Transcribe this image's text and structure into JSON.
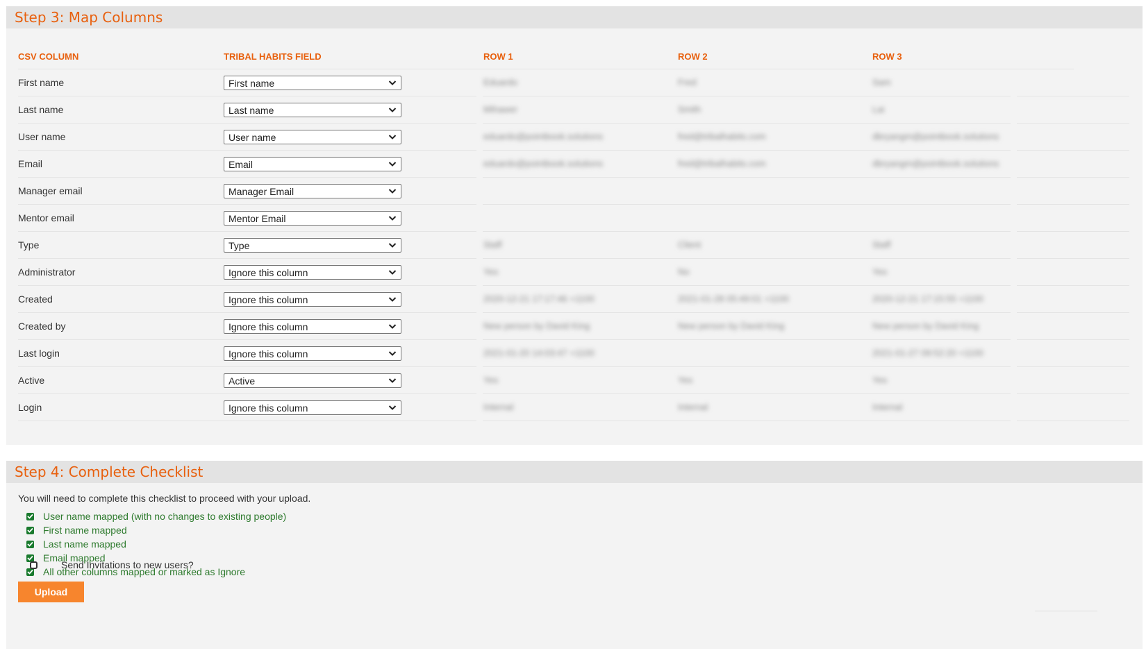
{
  "step3": {
    "title": "Step 3: Map Columns",
    "headers": {
      "csv_column": "CSV COLUMN",
      "field": "TRIBAL HABITS FIELD",
      "row1": "ROW 1",
      "row2": "ROW 2",
      "row3": "ROW 3"
    },
    "rows": [
      {
        "csv": "First name",
        "field": "First name",
        "r1": "Eduardo",
        "r2": "Fred",
        "r3": "Sam"
      },
      {
        "csv": "Last name",
        "field": "Last name",
        "r1": "Mihawer",
        "r2": "Smith",
        "r3": "Lai"
      },
      {
        "csv": "User name",
        "field": "User name",
        "r1": "eduardo@pointbook.solutions",
        "r2": "fred@tribalhabits.com",
        "r3": "dbryangm@pointbook.solutions"
      },
      {
        "csv": "Email",
        "field": "Email",
        "r1": "eduardo@pointbook.solutions",
        "r2": "fred@tribalhabits.com",
        "r3": "dbryangm@pointbook.solutions"
      },
      {
        "csv": "Manager email",
        "field": "Manager Email",
        "r1": "",
        "r2": "",
        "r3": ""
      },
      {
        "csv": "Mentor email",
        "field": "Mentor Email",
        "r1": "",
        "r2": "",
        "r3": ""
      },
      {
        "csv": "Type",
        "field": "Type",
        "r1": "Staff",
        "r2": "Client",
        "r3": "Staff"
      },
      {
        "csv": "Administrator",
        "field": "Ignore this column",
        "r1": "Yes",
        "r2": "No",
        "r3": "Yes"
      },
      {
        "csv": "Created",
        "field": "Ignore this column",
        "r1": "2020-12-21 17:17:46 +1100",
        "r2": "2021-01-28 05:49:01 +1100",
        "r3": "2020-12-21 17:15:55 +1100"
      },
      {
        "csv": "Created by",
        "field": "Ignore this column",
        "r1": "New person by David King",
        "r2": "New person by David King",
        "r3": "New person by David King"
      },
      {
        "csv": "Last login",
        "field": "Ignore this column",
        "r1": "2021-01-20 14:03:47 +1100",
        "r2": "",
        "r3": "2021-01-27 09:52:20 +1100"
      },
      {
        "csv": "Active",
        "field": "Active",
        "r1": "Yes",
        "r2": "Yes",
        "r3": "Yes"
      },
      {
        "csv": "Login",
        "field": "Ignore this column",
        "r1": "Internal",
        "r2": "Internal",
        "r3": "Internal"
      }
    ]
  },
  "step4": {
    "title": "Step 4: Complete Checklist",
    "intro": "You will need to complete this checklist to proceed with your upload.",
    "checks": [
      "User name mapped (with no changes to existing people)",
      "First name mapped",
      "Last name mapped",
      "Email mapped",
      "All other columns mapped or marked as Ignore"
    ],
    "invite_label": "Send Invitations to new users?",
    "upload_label": "Upload"
  },
  "colors": {
    "accent": "#e8600e",
    "button": "#f7852d",
    "check_green": "#2d7a2d",
    "panel_bg": "#f3f3f3",
    "header_bg": "#e3e3e3"
  },
  "icons": {
    "select_arrow": "chevron-down-icon",
    "checked": "checkbox-checked-icon",
    "unchecked": "checkbox-unchecked-icon"
  }
}
